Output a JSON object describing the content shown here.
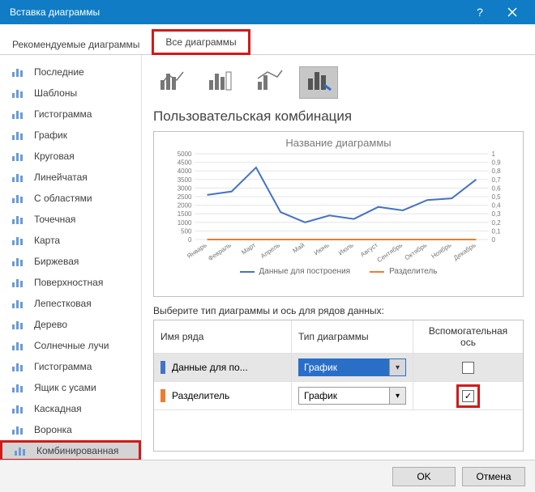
{
  "titlebar": {
    "title": "Вставка диаграммы"
  },
  "tabs": {
    "recommended": "Рекомендуемые диаграммы",
    "all": "Все диаграммы"
  },
  "sidebar": {
    "items": [
      {
        "label": "Последние"
      },
      {
        "label": "Шаблоны"
      },
      {
        "label": "Гистограмма"
      },
      {
        "label": "График"
      },
      {
        "label": "Круговая"
      },
      {
        "label": "Линейчатая"
      },
      {
        "label": "С областями"
      },
      {
        "label": "Точечная"
      },
      {
        "label": "Карта"
      },
      {
        "label": "Биржевая"
      },
      {
        "label": "Поверхностная"
      },
      {
        "label": "Лепестковая"
      },
      {
        "label": "Дерево"
      },
      {
        "label": "Солнечные лучи"
      },
      {
        "label": "Гистограмма"
      },
      {
        "label": "Ящик с усами"
      },
      {
        "label": "Каскадная"
      },
      {
        "label": "Воронка"
      },
      {
        "label": "Комбинированная"
      }
    ]
  },
  "main": {
    "section_title": "Пользовательская комбинация",
    "thumbs_selected_index": 3,
    "instruction": "Выберите тип диаграммы и ось для рядов данных:",
    "grid": {
      "headers": {
        "name": "Имя ряда",
        "type": "Тип диаграммы",
        "axis": "Вспомогательная ось"
      },
      "rows": [
        {
          "swatch": "#4472c4",
          "name": "Данные для по...",
          "type": "График",
          "aux": false,
          "active": true
        },
        {
          "swatch": "#ed7d31",
          "name": "Разделитель",
          "type": "График",
          "aux": true,
          "active": false
        }
      ]
    }
  },
  "chart_data": {
    "type": "line",
    "title": "Название диаграммы",
    "categories": [
      "Январь",
      "Февраль",
      "Март",
      "Апрель",
      "Май",
      "Июнь",
      "Июль",
      "Август",
      "Сентябрь",
      "Октябрь",
      "Ноябрь",
      "Декабрь"
    ],
    "series": [
      {
        "name": "Данные для построения",
        "axis": "primary",
        "color": "#4472c4",
        "values": [
          2600,
          2800,
          4200,
          1600,
          1000,
          1400,
          1200,
          1900,
          1700,
          2300,
          2400,
          3500
        ]
      },
      {
        "name": "Разделитель",
        "axis": "secondary",
        "color": "#ed7d31",
        "values": [
          0,
          0,
          0,
          0,
          0,
          0,
          0,
          0,
          0,
          0,
          0,
          0
        ]
      }
    ],
    "ylim": [
      0,
      5000
    ],
    "ystep": 500,
    "y2lim": [
      0,
      1
    ],
    "y2step": 0.1,
    "legend": [
      {
        "label": "Данные для построения",
        "color": "#4472c4"
      },
      {
        "label": "Разделитель",
        "color": "#ed7d31"
      }
    ]
  },
  "footer": {
    "ok": "OK",
    "cancel": "Отмена"
  }
}
